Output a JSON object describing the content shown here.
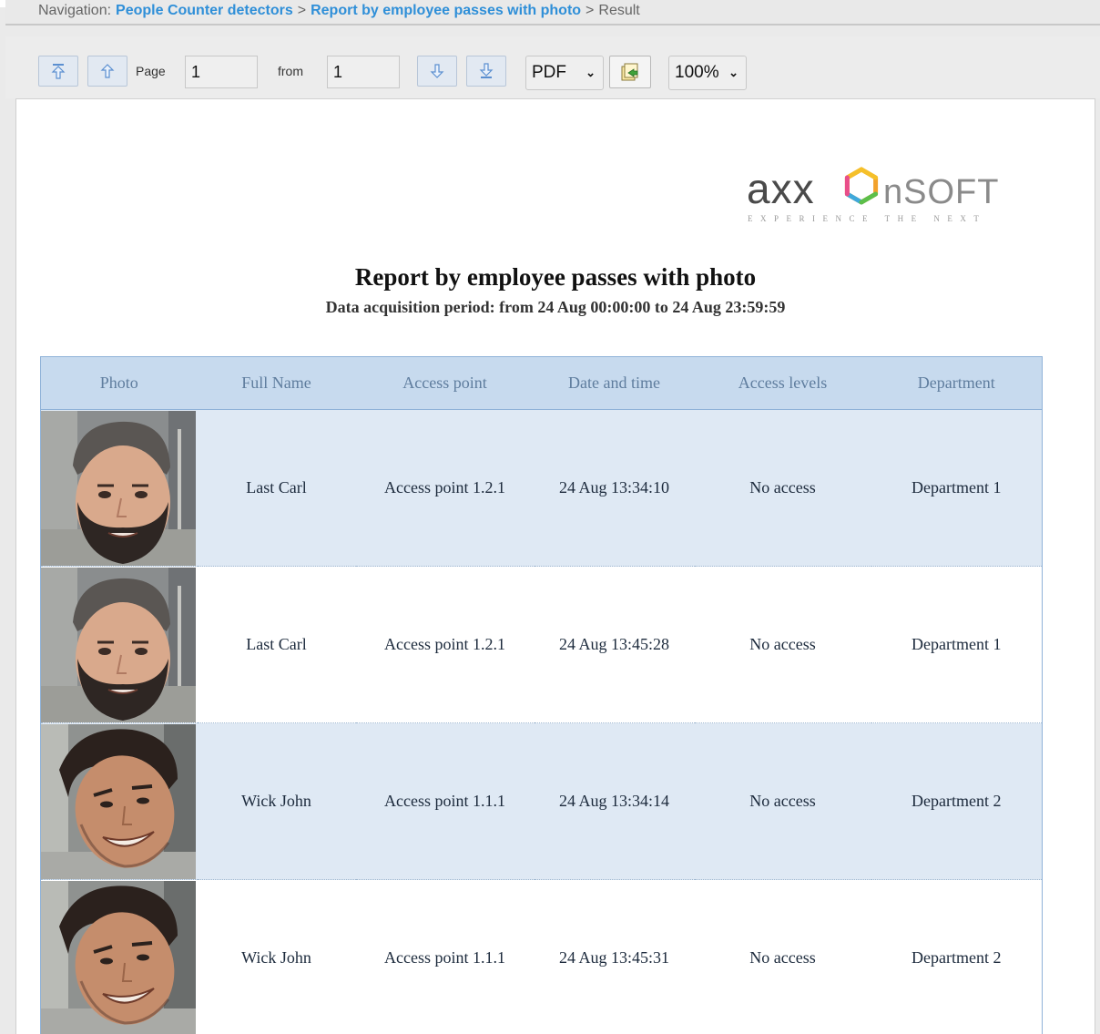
{
  "navigation": {
    "label": "Navigation:",
    "crumbs": [
      "People Counter detectors",
      "Report by employee passes with photo"
    ],
    "current": "Result",
    "separator": ">"
  },
  "toolbar": {
    "page_label": "Page",
    "page_value": "1",
    "from_label": "from",
    "from_value": "1",
    "format_value": "PDF",
    "zoom_value": "100%"
  },
  "logo": {
    "left_text": "axx",
    "right_text": "nSOFT",
    "tagline": "EXPERIENCE THE NEXT"
  },
  "report": {
    "title": "Report by employee passes with photo",
    "subtitle": "Data acquisition period: from 24 Aug 00:00:00 to 24 Aug 23:59:59",
    "columns": [
      "Photo",
      "Full Name",
      "Access point",
      "Date and time",
      "Access levels",
      "Department"
    ],
    "rows": [
      {
        "name": "Last Carl",
        "access_point": "Access point 1.2.1",
        "datetime": "24 Aug 13:34:10",
        "access_level": "No access",
        "department": "Department 1",
        "photo": "bearded-man-cap-photo"
      },
      {
        "name": "Last Carl",
        "access_point": "Access point 1.2.1",
        "datetime": "24 Aug 13:45:28",
        "access_level": "No access",
        "department": "Department 1",
        "photo": "bearded-man-cap-photo"
      },
      {
        "name": "Wick John",
        "access_point": "Access point 1.1.1",
        "datetime": "24 Aug 13:34:14",
        "access_level": "No access",
        "department": "Department 2",
        "photo": "smiling-young-man-photo"
      },
      {
        "name": "Wick John",
        "access_point": "Access point 1.1.1",
        "datetime": "24 Aug 13:45:31",
        "access_level": "No access",
        "department": "Department 2",
        "photo": "smiling-young-man-photo"
      }
    ]
  },
  "colors": {
    "link": "#2f8fd8",
    "header_bg": "#c7daee",
    "header_text": "#5f7d9e",
    "row_shade": "#dfe9f4",
    "border": "#8fb2d8"
  }
}
